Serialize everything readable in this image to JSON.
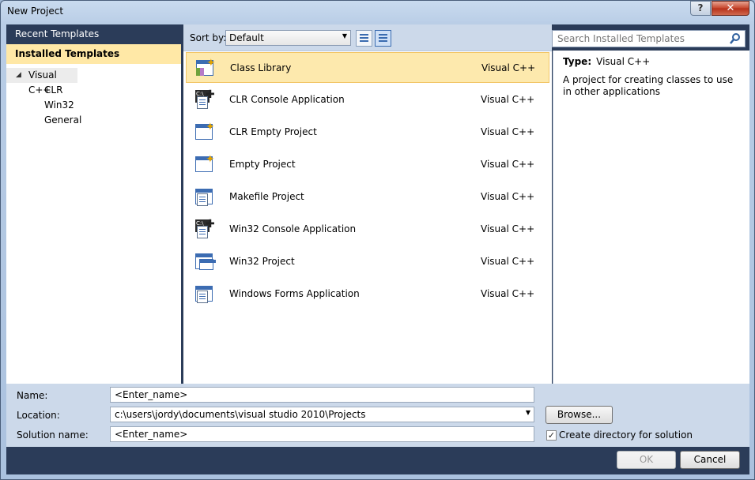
{
  "window": {
    "title": "New Project",
    "help_label": "?",
    "close_label": "✕"
  },
  "nav": {
    "recent": "Recent Templates",
    "installed": "Installed Templates"
  },
  "tree": {
    "root": "Visual C++",
    "children": [
      "CLR",
      "Win32",
      "General"
    ]
  },
  "sort": {
    "label": "Sort by:",
    "value": "Default"
  },
  "search": {
    "placeholder": "Search Installed Templates"
  },
  "templates": [
    {
      "name": "Class Library",
      "lang": "Visual C++",
      "icon": "class-library-icon"
    },
    {
      "name": "CLR Console Application",
      "lang": "Visual C++",
      "icon": "console-app-icon"
    },
    {
      "name": "CLR Empty Project",
      "lang": "Visual C++",
      "icon": "empty-project-icon"
    },
    {
      "name": "Empty Project",
      "lang": "Visual C++",
      "icon": "empty-project-icon"
    },
    {
      "name": "Makefile Project",
      "lang": "Visual C++",
      "icon": "makefile-project-icon"
    },
    {
      "name": "Win32 Console Application",
      "lang": "Visual C++",
      "icon": "console-app-icon"
    },
    {
      "name": "Win32 Project",
      "lang": "Visual C++",
      "icon": "win32-project-icon"
    },
    {
      "name": "Windows Forms Application",
      "lang": "Visual C++",
      "icon": "forms-app-icon"
    }
  ],
  "details": {
    "type_label": "Type:",
    "type_value": "Visual C++",
    "description": "A project for creating classes to use in other applications"
  },
  "form": {
    "name_label": "Name:",
    "name_value": "<Enter_name>",
    "location_label": "Location:",
    "location_value": "c:\\users\\jordy\\documents\\visual studio 2010\\Projects",
    "solution_label": "Solution name:",
    "solution_value": "<Enter_name>",
    "browse_label": "Browse...",
    "create_dir_label": "Create directory for solution",
    "create_dir_checked": true
  },
  "buttons": {
    "ok": "OK",
    "cancel": "Cancel"
  },
  "colors": {
    "accent": "#2b3c59",
    "selection": "#fde9ad",
    "panel": "#ccd9ea"
  }
}
